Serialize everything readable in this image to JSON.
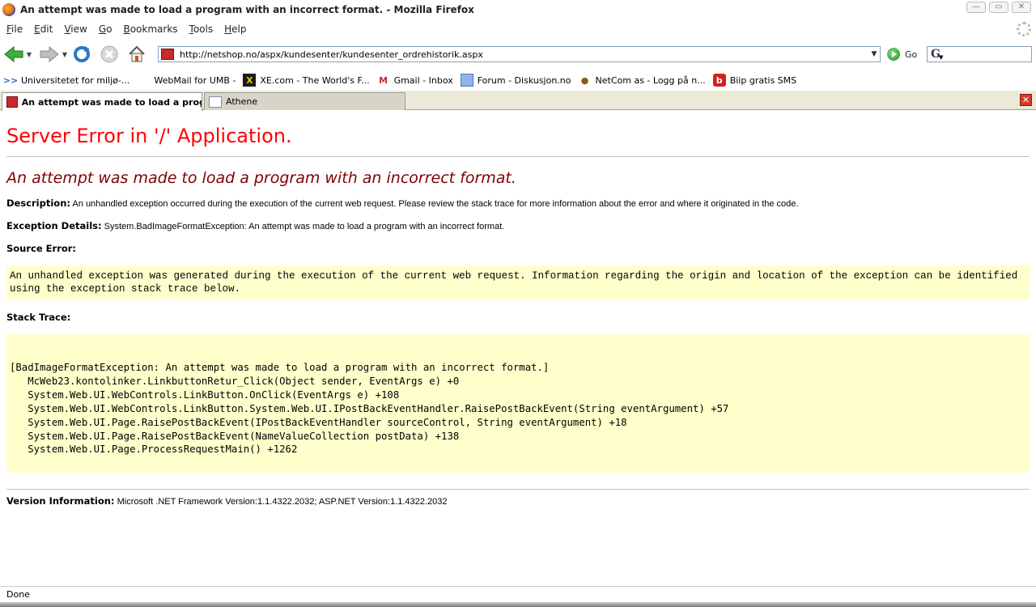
{
  "window": {
    "title": "An attempt was made to load a program with an incorrect format. - Mozilla Firefox"
  },
  "menu": {
    "items": [
      {
        "key": "F",
        "rest": "ile"
      },
      {
        "key": "E",
        "rest": "dit"
      },
      {
        "key": "V",
        "rest": "iew"
      },
      {
        "key": "G",
        "rest": "o"
      },
      {
        "key": "B",
        "rest": "ookmarks"
      },
      {
        "key": "T",
        "rest": "ools"
      },
      {
        "key": "H",
        "rest": "elp"
      }
    ]
  },
  "nav": {
    "url": "http://netshop.no/aspx/kundesenter/kundesenter_ordrehistorik.aspx",
    "go_label": "Go",
    "search_value": ""
  },
  "bookmarks": [
    {
      "label": "Universitetet for miljø-...",
      "icon": "double-chevron-icon"
    },
    {
      "label": "WebMail for UMB -",
      "icon": "blank-icon"
    },
    {
      "label": "XE.com - The World's F...",
      "icon": "xe-icon"
    },
    {
      "label": "Gmail - Inbox",
      "icon": "gmail-icon"
    },
    {
      "label": "Forum - Diskusjon.no",
      "icon": "forum-icon"
    },
    {
      "label": "NetCom as - Logg på n...",
      "icon": "netcom-icon"
    },
    {
      "label": "Biip gratis SMS",
      "icon": "biip-icon"
    }
  ],
  "tabs": [
    {
      "label": "An attempt was made to load a program...",
      "active": true
    },
    {
      "label": "Athene",
      "active": false
    }
  ],
  "page": {
    "heading": "Server Error in '/' Application.",
    "error_title": "An attempt was made to load a program with an incorrect format.",
    "description_label": "Description:",
    "description_text": " An unhandled exception occurred during the execution of the current web request. Please review the stack trace for more information about the error and where it originated in the code.",
    "exception_label": "Exception Details:",
    "exception_text": " System.BadImageFormatException: An attempt was made to load a program with an incorrect format.",
    "source_error_label": "Source Error:",
    "source_error_text": "An unhandled exception was generated during the execution of the current web request. Information regarding the origin and location of the exception can be identified using the exception stack trace below.",
    "stack_trace_label": "Stack Trace:",
    "stack_trace": [
      "[BadImageFormatException: An attempt was made to load a program with an incorrect format.]",
      "   McWeb23.kontolinker.LinkbuttonRetur_Click(Object sender, EventArgs e) +0",
      "   System.Web.UI.WebControls.LinkButton.OnClick(EventArgs e) +108",
      "   System.Web.UI.WebControls.LinkButton.System.Web.UI.IPostBackEventHandler.RaisePostBackEvent(String eventArgument) +57",
      "   System.Web.UI.Page.RaisePostBackEvent(IPostBackEventHandler sourceControl, String eventArgument) +18",
      "   System.Web.UI.Page.RaisePostBackEvent(NameValueCollection postData) +138",
      "   System.Web.UI.Page.ProcessRequestMain() +1262"
    ],
    "version_label": "Version Information:",
    "version_text": " Microsoft .NET Framework Version:1.1.4322.2032; ASP.NET Version:1.1.4322.2032"
  },
  "status": {
    "text": "Done"
  }
}
